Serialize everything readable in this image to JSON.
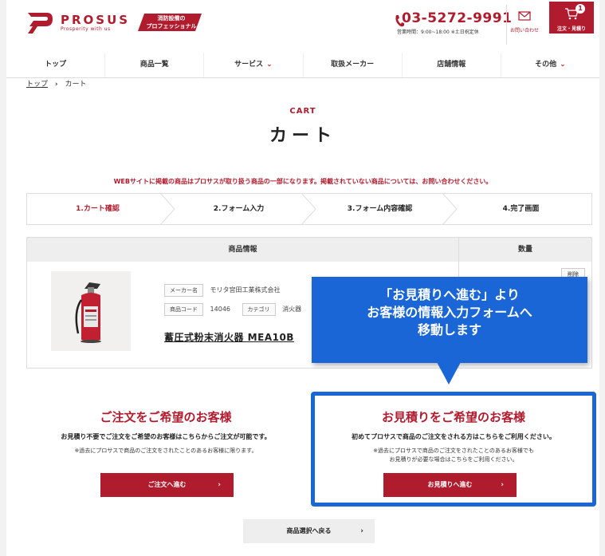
{
  "header": {
    "logo_text": "PROSUS",
    "logo_sub": "Prosperity with us",
    "badge_line1": "消防設備の",
    "badge_line2": "プロフェッショナル",
    "phone": "03-5272-9991",
    "hours": "営業時間：9:00~18:00 ※土日祝定休",
    "contact_label": "お問い合わせ",
    "cart_label": "注文・見積り",
    "cart_count": "1"
  },
  "nav": {
    "items": [
      {
        "label": "トップ",
        "dropdown": false
      },
      {
        "label": "商品一覧",
        "dropdown": false
      },
      {
        "label": "サービス",
        "dropdown": true
      },
      {
        "label": "取扱メーカー",
        "dropdown": false
      },
      {
        "label": "店舗情報",
        "dropdown": false
      },
      {
        "label": "その他",
        "dropdown": true
      }
    ],
    "dropdown_glyph": "⌄"
  },
  "breadcrumb": {
    "home": "トップ",
    "separator": "›",
    "current": "カート"
  },
  "page": {
    "title_en": "CART",
    "title_jp": "カート",
    "notice": "WEBサイトに掲載の商品はプロサスが取り扱う商品の一部になります。掲載されていない商品については、お問い合わせください。"
  },
  "steps": [
    {
      "label": "1.カート確認",
      "active": true
    },
    {
      "label": "2.フォーム入力",
      "active": false
    },
    {
      "label": "3.フォーム内容確認",
      "active": false
    },
    {
      "label": "4.完了画面",
      "active": false
    }
  ],
  "table": {
    "col_product": "商品情報",
    "col_qty": "数量",
    "delete_label": "削除",
    "product": {
      "maker_label": "メーカー名",
      "maker": "モリタ宮田工業株式会社",
      "code_label": "商品コード",
      "code": "14046",
      "category_label": "カテゴリ",
      "category": "消火器",
      "name": "蓄圧式粉末消火器 MEA10B"
    }
  },
  "callout": {
    "line1": "「お見積りへ進む」より",
    "line2": "お客様の情報入力フォームへ",
    "line3": "移動します",
    "color": "#1a66d6"
  },
  "order_section": {
    "title": "ご注文をご希望のお客様",
    "desc": "お見積り不要でご注文をご希望のお客様はこちらからご注文が可能です。",
    "note": "※過去にプロサスで商品のご注文をされたことのあるお客様に限ります。",
    "button": "ご注文へ進む"
  },
  "estimate_section": {
    "title": "お見積りをご希望のお客様",
    "desc": "初めてプロサスで商品のご注文をされる方はこちらをご利用ください。",
    "note1": "※過去にプロサスで商品のご注文をされたことのあるお客様でも",
    "note2": "お見積りが必要な場合はこちらをご利用ください。",
    "button": "お見積りへ進む"
  },
  "back_button": "商品選択へ戻る",
  "chevron": "›",
  "colors": {
    "brand": "#b01c2e",
    "highlight": "#1a66d6"
  }
}
